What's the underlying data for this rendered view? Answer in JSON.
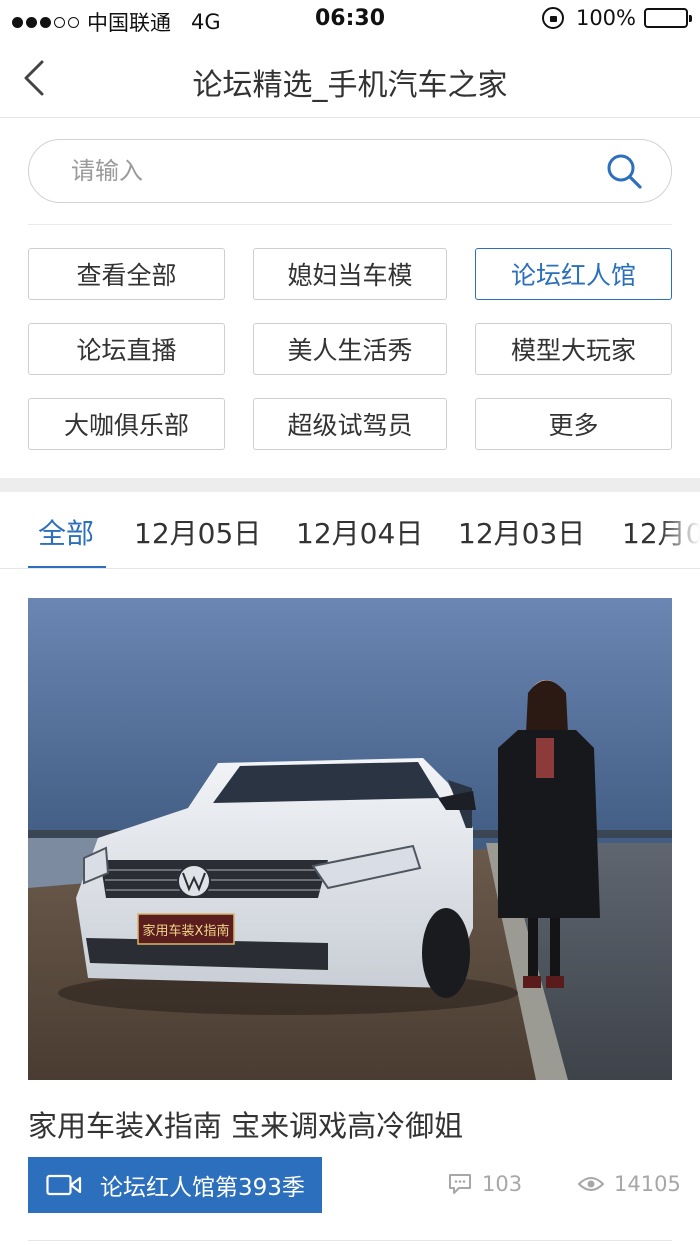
{
  "status_bar": {
    "carrier": "中国联通",
    "network": "4G",
    "time": "06:30",
    "battery": "100%"
  },
  "nav": {
    "title": "论坛精选_手机汽车之家"
  },
  "search": {
    "placeholder": "请输入"
  },
  "categories": [
    {
      "label": "查看全部",
      "active": false
    },
    {
      "label": "媳妇当车模",
      "active": false
    },
    {
      "label": "论坛红人馆",
      "active": true
    },
    {
      "label": "论坛直播",
      "active": false
    },
    {
      "label": "美人生活秀",
      "active": false
    },
    {
      "label": "模型大玩家",
      "active": false
    },
    {
      "label": "大咖俱乐部",
      "active": false
    },
    {
      "label": "超级试驾员",
      "active": false
    },
    {
      "label": "更多",
      "active": false
    }
  ],
  "date_tabs": [
    {
      "label": "全部",
      "active": true
    },
    {
      "label": "12月05日",
      "active": false
    },
    {
      "label": "12月04日",
      "active": false
    },
    {
      "label": "12月03日",
      "active": false
    },
    {
      "label": "12月0",
      "active": false
    }
  ],
  "article": {
    "plate_text": "家用车装X指南",
    "title": "家用车装X指南 宝来调戏高冷御姐",
    "tag": "论坛红人馆第393季",
    "comments": "103",
    "views": "14105"
  },
  "colors": {
    "accent": "#2b6fbd",
    "text": "#333333",
    "muted": "#a7a7a7"
  }
}
